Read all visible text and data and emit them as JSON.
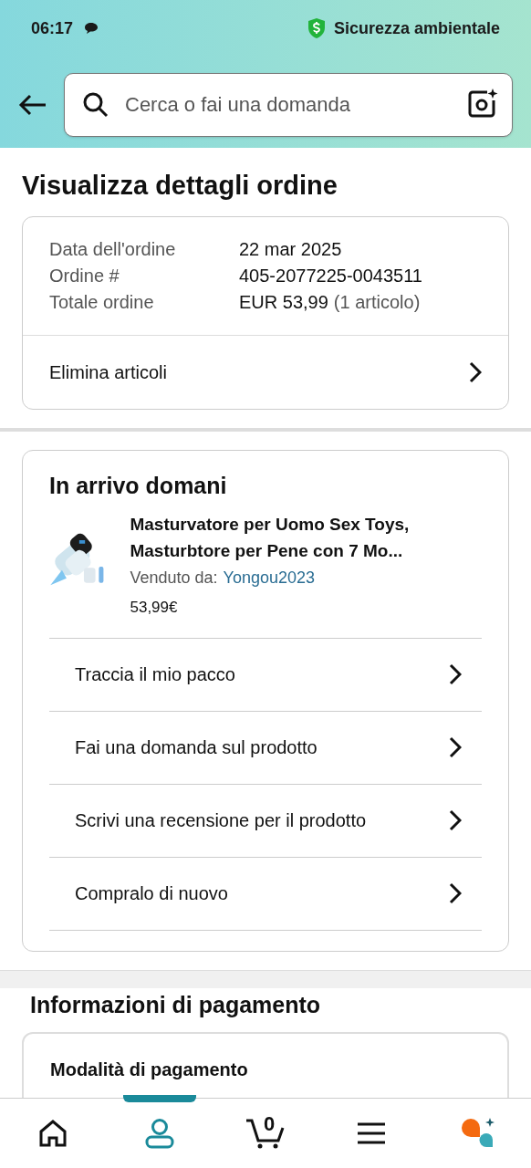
{
  "status_bar": {
    "time": "06:17",
    "security_label": "Sicurezza ambientale"
  },
  "search": {
    "placeholder": "Cerca o fai una domanda"
  },
  "page_title": "Visualizza dettagli ordine",
  "order_summary": {
    "rows": [
      {
        "label": "Data dell'ordine",
        "value": "22 mar 2025"
      },
      {
        "label": "Ordine #",
        "value": "405-2077225-0043511"
      },
      {
        "label": "Totale ordine",
        "value": "EUR 53,99",
        "note": "(1 articolo)"
      }
    ],
    "action": "Elimina articoli"
  },
  "shipment": {
    "heading": "In arrivo domani",
    "product": {
      "kind": "picture",
      "title": "Masturvatore per Uomo Sex Toys, Masturbtore per Pene con 7 Mo...",
      "seller_label": "Venduto da:",
      "seller": "Yongou2023",
      "price": "53,99€"
    },
    "actions": [
      "Traccia il mio pacco",
      "Fai una domanda sul prodotto",
      "Scrivi una recensione per il prodotto",
      "Compralo di nuovo"
    ]
  },
  "payment": {
    "heading": "Informazioni di pagamento",
    "method_label": "Modalità di pagamento"
  },
  "bottom_nav": [
    {
      "kind": "home",
      "selected": false
    },
    {
      "kind": "account",
      "selected": true
    },
    {
      "kind": "cart",
      "count": "0",
      "selected": false
    },
    {
      "kind": "menu",
      "selected": false
    },
    {
      "kind": "assistant",
      "selected": false
    }
  ]
}
